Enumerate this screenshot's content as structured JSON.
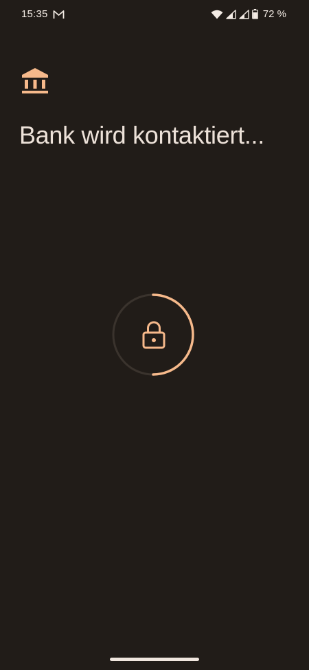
{
  "status_bar": {
    "time": "15:35",
    "notification_icon": "gmail-icon",
    "icons": [
      "wifi-icon",
      "signal-icon",
      "signal-icon",
      "battery-icon"
    ],
    "battery_percent": "72 %"
  },
  "header": {
    "icon": "bank-icon",
    "title": "Bank wird kontaktiert..."
  },
  "progress": {
    "icon": "lock-icon",
    "fraction": 0.5
  },
  "colors": {
    "background": "#211c18",
    "accent": "#f6b98b",
    "text": "#ede2d9",
    "track": "#3a332d"
  }
}
